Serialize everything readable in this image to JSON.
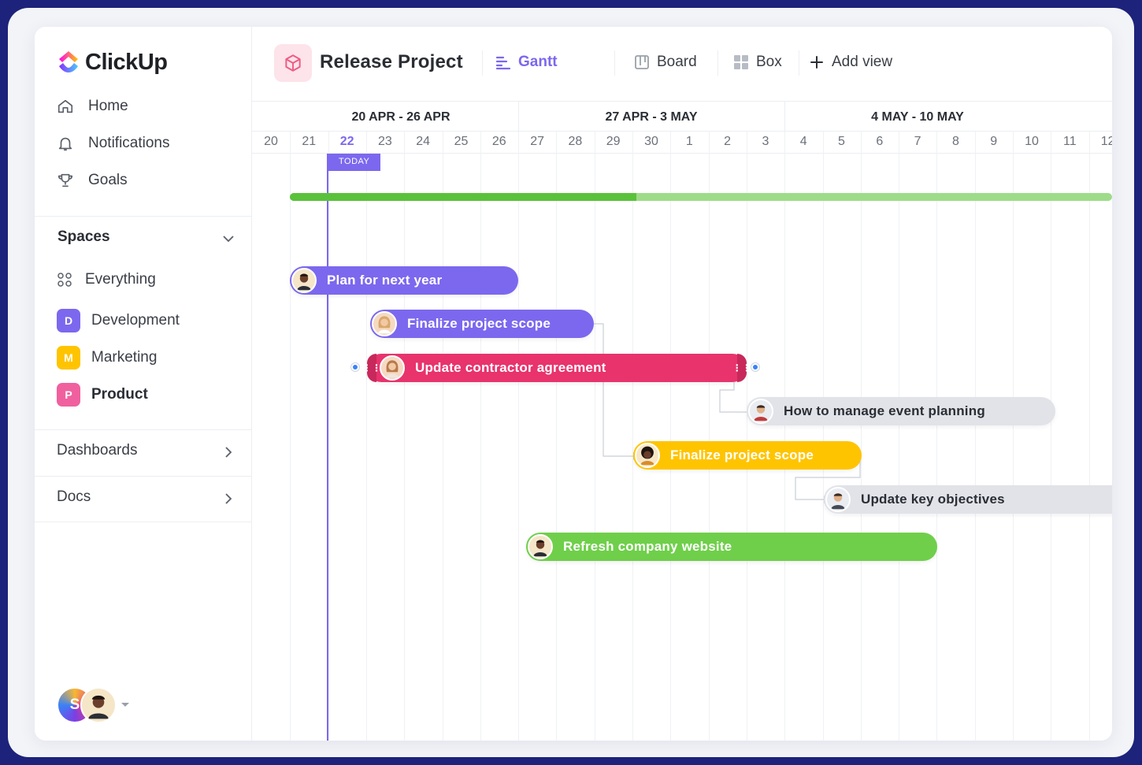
{
  "sidebar": {
    "logo": "ClickUp",
    "nav": [
      {
        "label": "Home",
        "icon": "home-icon"
      },
      {
        "label": "Notifications",
        "icon": "bell-icon"
      },
      {
        "label": "Goals",
        "icon": "trophy-icon"
      }
    ],
    "spaces_label": "Spaces",
    "spaces": [
      {
        "label": "Everything",
        "icon": "grid-dots-icon"
      },
      {
        "label": "Development",
        "badge": "D",
        "color": "#7b68ee"
      },
      {
        "label": "Marketing",
        "badge": "M",
        "color": "#ffc400"
      },
      {
        "label": "Product",
        "badge": "P",
        "color": "#f0609e"
      }
    ],
    "dashboards_label": "Dashboards",
    "docs_label": "Docs",
    "user_initial": "S"
  },
  "header": {
    "project_title": "Release Project",
    "views": [
      {
        "label": "Gantt",
        "icon": "gantt-icon",
        "active": true
      },
      {
        "label": "Board",
        "icon": "board-icon",
        "active": false
      },
      {
        "label": "Box",
        "icon": "box-icon",
        "active": false
      }
    ],
    "add_view_label": "Add view"
  },
  "gantt": {
    "weeks": [
      "20 APR - 26 APR",
      "27 APR - 3 MAY",
      "4 MAY - 10 MAY"
    ],
    "days": [
      "20",
      "21",
      "22",
      "23",
      "24",
      "25",
      "26",
      "27",
      "28",
      "29",
      "30",
      "1",
      "2",
      "3",
      "4",
      "5",
      "6",
      "7",
      "8",
      "9",
      "10",
      "11",
      "12"
    ],
    "today_label": "TODAY",
    "today": "22",
    "tasks": [
      {
        "label": "Plan for next year",
        "color": "#7b68ee"
      },
      {
        "label": "Finalize project scope",
        "color": "#7b68ee"
      },
      {
        "label": "Update contractor agreement",
        "color": "#e8336d"
      },
      {
        "label": "How to manage event planning",
        "color": "#e1e3e8"
      },
      {
        "label": "Finalize project scope",
        "color": "#ffc400"
      },
      {
        "label": "Update key objectives",
        "color": "#e1e3e8"
      },
      {
        "label": "Refresh company website",
        "color": "#6fcf4a"
      }
    ]
  }
}
